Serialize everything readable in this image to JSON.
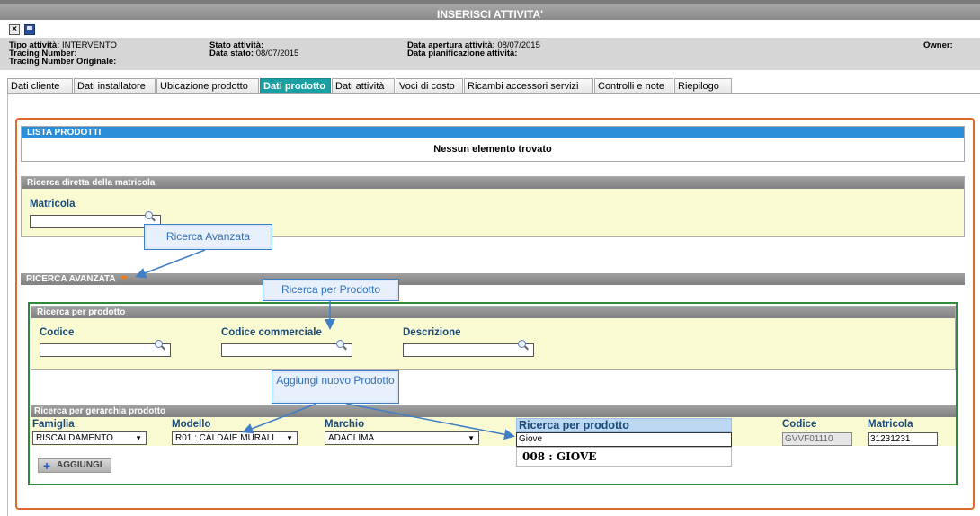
{
  "window": {
    "title": "INSERISCI ATTIVITA'"
  },
  "toolbar": {
    "close_icon": "close-icon",
    "save_icon": "save-icon"
  },
  "info": {
    "tipo_label": "Tipo attività:",
    "tipo_value": "INTERVENTO",
    "tracing_label": "Tracing Number:",
    "tracing_orig_label": "Tracing Number Originale:",
    "stato_label": "Stato attività:",
    "data_stato_label": "Data stato:",
    "data_stato_value": "08/07/2015",
    "apertura_label": "Data apertura attività:",
    "apertura_value": "08/07/2015",
    "pianificazione_label": "Data pianificazione attività:",
    "owner_label": "Owner:"
  },
  "tabs": [
    "Dati cliente",
    "Dati installatore",
    "Ubicazione prodotto",
    "Dati prodotto",
    "Dati attività",
    "Voci di costo",
    "Ricambi accessori servizi",
    "Controlli e note",
    "Riepilogo"
  ],
  "lista": {
    "title": "LISTA PRODOTTI",
    "empty": "Nessun elemento trovato"
  },
  "ricerca_diretta": {
    "title": "Ricerca diretta della matricola",
    "matricola_label": "Matricola",
    "matricola_value": ""
  },
  "ricerca_avanzata": {
    "title": "RICERCA AVANZATA"
  },
  "per_prodotto": {
    "title": "Ricerca per prodotto",
    "codice_label": "Codice",
    "codice_commerciale_label": "Codice commerciale",
    "descrizione_label": "Descrizione"
  },
  "gerarchia": {
    "title": "Ricerca per gerarchia prodotto",
    "famiglia_label": "Famiglia",
    "famiglia_value": "RISCALDAMENTO",
    "modello_label": "Modello",
    "modello_value": "R01 : CALDAIE MURALI",
    "marchio_label": "Marchio",
    "marchio_value": "ADACLIMA",
    "ricerca_label": "Ricerca per prodotto",
    "ricerca_value": "Giove",
    "suggestion": "008 : GIOVE",
    "codice_label": "Codice",
    "codice_value": "GVVF01110",
    "matricola_label": "Matricola",
    "matricola_value": "31231231",
    "aggiungi_label": "AGGIUNGI"
  },
  "callouts": {
    "avanzata": "Ricerca Avanzata",
    "per_prodotto": "Ricerca per Prodotto",
    "nuovo_prodotto": "Aggiungi nuovo Prodotto"
  },
  "colors": {
    "accent_teal": "#1a9fa4",
    "border_orange": "#e0692d",
    "header_blue": "#2a8fd8",
    "frame_green": "#2e8b3a"
  }
}
